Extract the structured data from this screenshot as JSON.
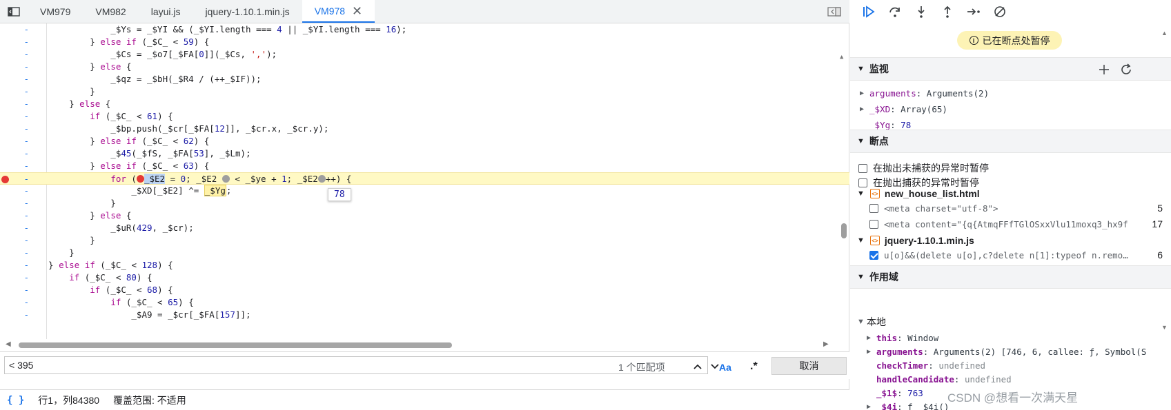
{
  "editor": {
    "tabs": [
      "VM979",
      "VM982",
      "layui.js",
      "jquery-1.10.1.min.js",
      "VM978"
    ],
    "active_tab_index": 4,
    "line_marker": "-",
    "tooltip_value": "78",
    "code_lines": [
      "            _$Ys = _$YI && (_$YI.length === 4 || _$YI.length === 16);",
      "        } else if (_$C_ < 59) {",
      "            _$Cs = _$o7[_$FA[0]](_$Cs, ',');",
      "        } else {",
      "            _$qz = _$bH(_$R4 / (++_$IF));",
      "        }",
      "    } else {",
      "        if (_$C_ < 61) {",
      "            _$bp.push(_$cr[_$FA[12]], _$cr.x, _$cr.y);",
      "        } else if (_$C_ < 62) {",
      "            _$45(_$fS, _$FA[53], _$Lm);",
      "        } else if (_$C_ < 63) {",
      "            for (_$E2 = 0; _$E2 < _$ye + 1; _$E2++) {",
      "                _$XD[_$E2] ^= _$Yg;",
      "            }",
      "        } else {",
      "            _$uR(429, _$cr);",
      "        }",
      "    }",
      "} else if (_$C_ < 128) {",
      "    if (_$C_ < 80) {",
      "        if (_$C_ < 68) {",
      "            if (_$C_ < 65) {",
      "                _$A9 = _$cr[_$FA[157]];"
    ]
  },
  "search": {
    "query": "< 395",
    "match_count": "1 个匹配项",
    "case_label": "Aa",
    "regex_label": ".*",
    "cancel_label": "取消"
  },
  "status": {
    "braces": "{ }",
    "position": "行1，列84380",
    "coverage": "覆盖范围: 不适用"
  },
  "debugger": {
    "paused_label": "已在断点处暂停",
    "watch": {
      "title": "监视",
      "items": [
        {
          "name": "arguments",
          "value": "Arguments(2)",
          "expandable": true
        },
        {
          "name": "_$XD",
          "value": "Array(65)",
          "expandable": true
        },
        {
          "name": "_$Yg",
          "value": "78",
          "expandable": false
        }
      ]
    },
    "breakpoints": {
      "title": "断点",
      "pause_uncaught": "在抛出未捕获的异常时暂停",
      "pause_caught": "在抛出捕获的异常时暂停",
      "files": [
        {
          "name": "new_house_list.html",
          "entries": [
            {
              "code": "<meta charset=\"utf-8\">",
              "line": "5",
              "checked": false
            },
            {
              "code": "<meta content=\"{q{AtmqFFfTGlOSxxVlu11moxq3_hx9f",
              "line": "17",
              "checked": false
            }
          ]
        },
        {
          "name": "jquery-1.10.1.min.js",
          "entries": [
            {
              "code": "u[o]&&(delete u[o],c?delete n[1]:typeof n.removeAttr",
              "line": "6",
              "checked": true
            }
          ]
        }
      ]
    },
    "scope": {
      "title": "作用域",
      "local_label": "本地",
      "items": [
        {
          "name": "this",
          "value": "Window",
          "expandable": true
        },
        {
          "name": "arguments",
          "value": "Arguments(2) [746, 6, callee: ƒ, Symbol(S",
          "expandable": true
        },
        {
          "name": "checkTimer",
          "value": "undefined",
          "expandable": false
        },
        {
          "name": "handleCandidate",
          "value": "undefined",
          "expandable": false
        },
        {
          "name": "_$1$",
          "value": "763",
          "expandable": false
        },
        {
          "name": "_$4i",
          "value": "ƒ _$4i()",
          "expandable": true
        }
      ]
    }
  },
  "watermark": "CSDN @想看一次满天星",
  "colors": {
    "accent": "#1a73e8",
    "breakpoint": "#e53935",
    "paused_bg": "#fdf3b5",
    "highlight_line": "#fff9c4"
  }
}
